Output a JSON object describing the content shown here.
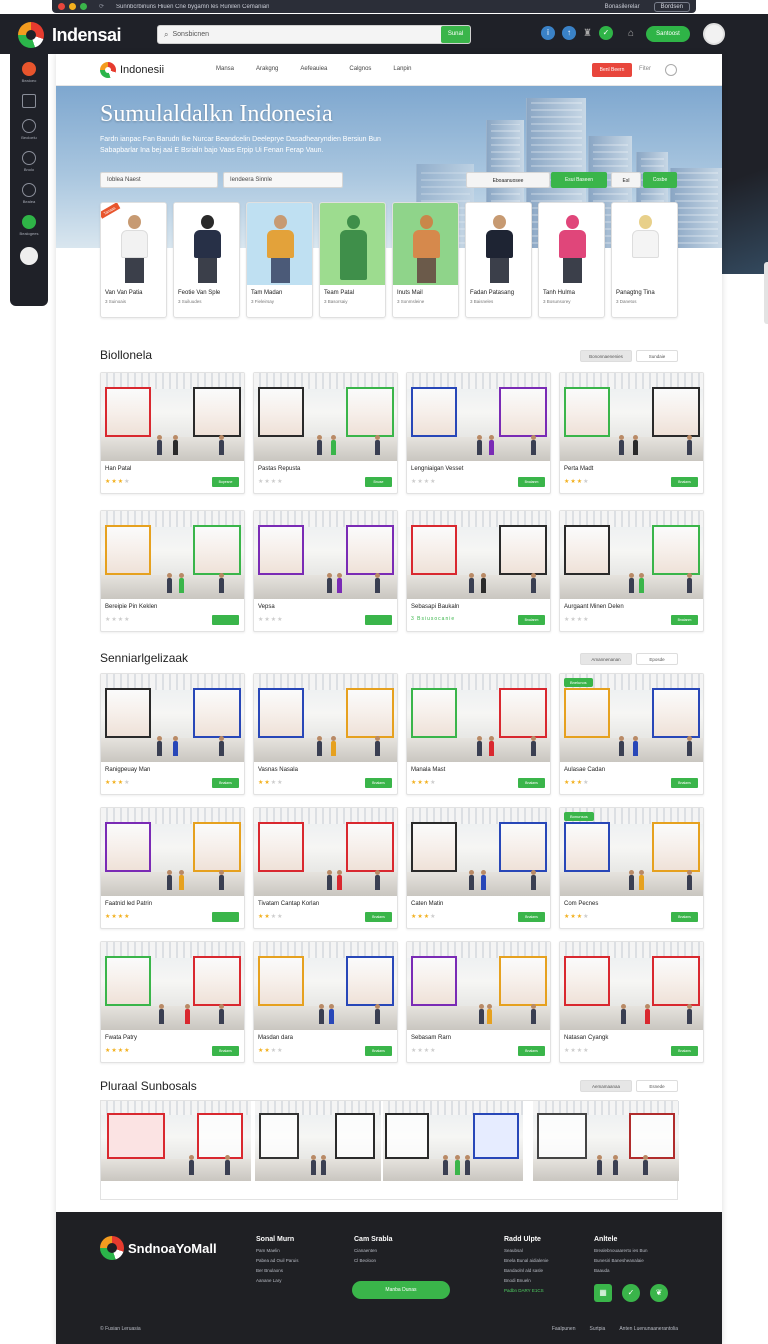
{
  "browser": {
    "tab_text": "Sunnbcrbinuns Hiuen Cne bygamn les Runilen Cemanian",
    "right_button": "Bordsen",
    "right_text": "Bonasilerelar"
  },
  "app": {
    "name": "Indensai",
    "search_placeholder": "Sonsbicnen",
    "search_button": "Sunal",
    "cta_label": "Santoost",
    "accent": "#3ab54a",
    "dark": "#1f2128"
  },
  "sidebar": {
    "items": [
      {
        "icon": "flag-icon",
        "label": "Bealoeo"
      },
      {
        "icon": "building-icon",
        "label": ""
      },
      {
        "icon": "face-icon",
        "label": "Beoloelu"
      },
      {
        "icon": "clock-icon",
        "label": "Bnolo"
      },
      {
        "icon": "globe-icon",
        "label": "Bealea"
      },
      {
        "icon": "play-icon",
        "label": "Bealogees"
      },
      {
        "icon": "user-icon",
        "label": ""
      }
    ]
  },
  "nav": {
    "brand": "Indonesii",
    "links": [
      "Mansa",
      "Arakgng",
      "Aefeauiea",
      "Calgnos",
      "Lanpin"
    ],
    "red_button": "Benl Beern",
    "link": "Fiter"
  },
  "hero": {
    "title": "Sumulaldalkn Indonesia",
    "subtitle": "Fardn ianpac Fan Barudn Ike Nurcar Beandcelin Deeleprye Dasadhearyndien Bersiun Bun Sabapbarlar Ina bej aai E Bsrialn bajo Vaas Erpip Ui Fenan Ferap Vaun.",
    "field1": "Ioblea Naest",
    "field2": "Iendeera Sinnle",
    "seg1": "Eboaanuosee",
    "seg2": "Esui Baseen",
    "seg3": "Esl",
    "seg4": "Cosbe"
  },
  "people": [
    {
      "name": "Van Van Patia",
      "meta": "3 Suinoais",
      "ribbon": "Tanaas"
    },
    {
      "name": "Feotie Van Sple",
      "meta": "3 Suiluudes"
    },
    {
      "name": "Tam Madan",
      "meta": "3 Fieleirsay"
    },
    {
      "name": "Team Patal",
      "meta": "3 Basorsaiy"
    },
    {
      "name": "Inuts Mail",
      "meta": "3 Sonmsleine"
    },
    {
      "name": "Fadan Patasang",
      "meta": "3 Baisneles"
    },
    {
      "name": "Tanh Hulma",
      "meta": "3 Bosunsorey"
    },
    {
      "name": "Panagtng Tina",
      "meta": "3 Danetos"
    }
  ],
  "sections": [
    {
      "title": "Biollonela",
      "btn1": "Bononnaenenies",
      "btn2": "Sundaie",
      "cards": [
        {
          "name": "Han Patal",
          "stars": 3,
          "btn": "Bupesne"
        },
        {
          "name": "Pastas Repusta",
          "stars": 0,
          "btn": "Bnuse"
        },
        {
          "name": "Lengniaigan Vesset",
          "stars": 0,
          "btn": "Bnalanm"
        },
        {
          "name": "Perta Madt",
          "stars": 3,
          "btn": "Bnalans"
        },
        {
          "name": "Bereipie Pin Keklen",
          "stars": 0,
          "btn": ""
        },
        {
          "name": "Vepsa",
          "stars": 0,
          "btn": ""
        },
        {
          "name": "Sebasapi Baukaln",
          "meta": "3 Bsiusocanie",
          "stars": 0,
          "btn": "Bnalanm"
        },
        {
          "name": "Aurgaant Minen Delen",
          "stars": 0,
          "btn": "Bnalanm"
        }
      ]
    },
    {
      "title": "Senniarlgelizaak",
      "btn1": "Amannenanan",
      "btn2": "Eposde",
      "cards": [
        {
          "name": "Ranigpeuay Man",
          "stars": 3,
          "btn": "Bnalans"
        },
        {
          "name": "Vasnas Nasala",
          "stars": 2,
          "btn": "Bnalans"
        },
        {
          "name": "Manala Mast",
          "stars": 3,
          "btn": "Bnalans"
        },
        {
          "name": "Aulasae Cadan",
          "stars": 3,
          "btn": "Bnalans",
          "badge": "Bnelunos"
        },
        {
          "name": "Faatnid led Patrin",
          "stars": 4,
          "btn": ""
        },
        {
          "name": "Tivatam Cantap Korlan",
          "stars": 2,
          "btn": "Bnalans"
        },
        {
          "name": "Caten Matin",
          "stars": 3,
          "btn": "Bnalans"
        },
        {
          "name": "Com Pecnes",
          "stars": 3,
          "btn": "Bnalans",
          "badge": "Bonunsos"
        },
        {
          "name": "Fwata Patry",
          "stars": 4,
          "btn": "Bnalans"
        },
        {
          "name": "Masdan dara",
          "stars": 2,
          "btn": "Bnalans"
        },
        {
          "name": "Sebasam Rarn",
          "stars": 0,
          "btn": "Bnalans"
        },
        {
          "name": "Natasan Cyangk",
          "stars": 0,
          "btn": "Bnalans"
        }
      ]
    },
    {
      "title": "Pluraal Sunbosals",
      "btn1": "Aemamaanaa",
      "btn2": "Esnede"
    }
  ],
  "footer": {
    "brand": "SndnoaYoMall",
    "col1": {
      "title": "Sonal Murn",
      "links": [
        "Pam Maelin",
        "Pabea ad Ouil Paruis",
        "Ber Bnulaons",
        "Aanane Lary"
      ]
    },
    "col2": {
      "title": "Cam Srabla",
      "links": [
        "Cianaenten",
        "Cl Beoloon"
      ],
      "button": "Manba Dunas"
    },
    "col3": {
      "title": "Radd Ulpte",
      "links": [
        "Seaubsal",
        "Bnela Bunal aidialenie",
        "Bandaolnl ald sasle",
        "Bnodi Bnueln"
      ],
      "green": "Padbn DARY E1CS"
    },
    "col4": {
      "title": "Anltele",
      "links": [
        "Brealebnouaarerto ies Bun",
        "Bunesiri Banesheanalaie",
        "Baauda"
      ]
    },
    "bottom_left": "Fusian Leruasia",
    "bottom_right": [
      "Faalpunen",
      "Surtpia",
      "Anten Luenunaanerantolia"
    ]
  }
}
